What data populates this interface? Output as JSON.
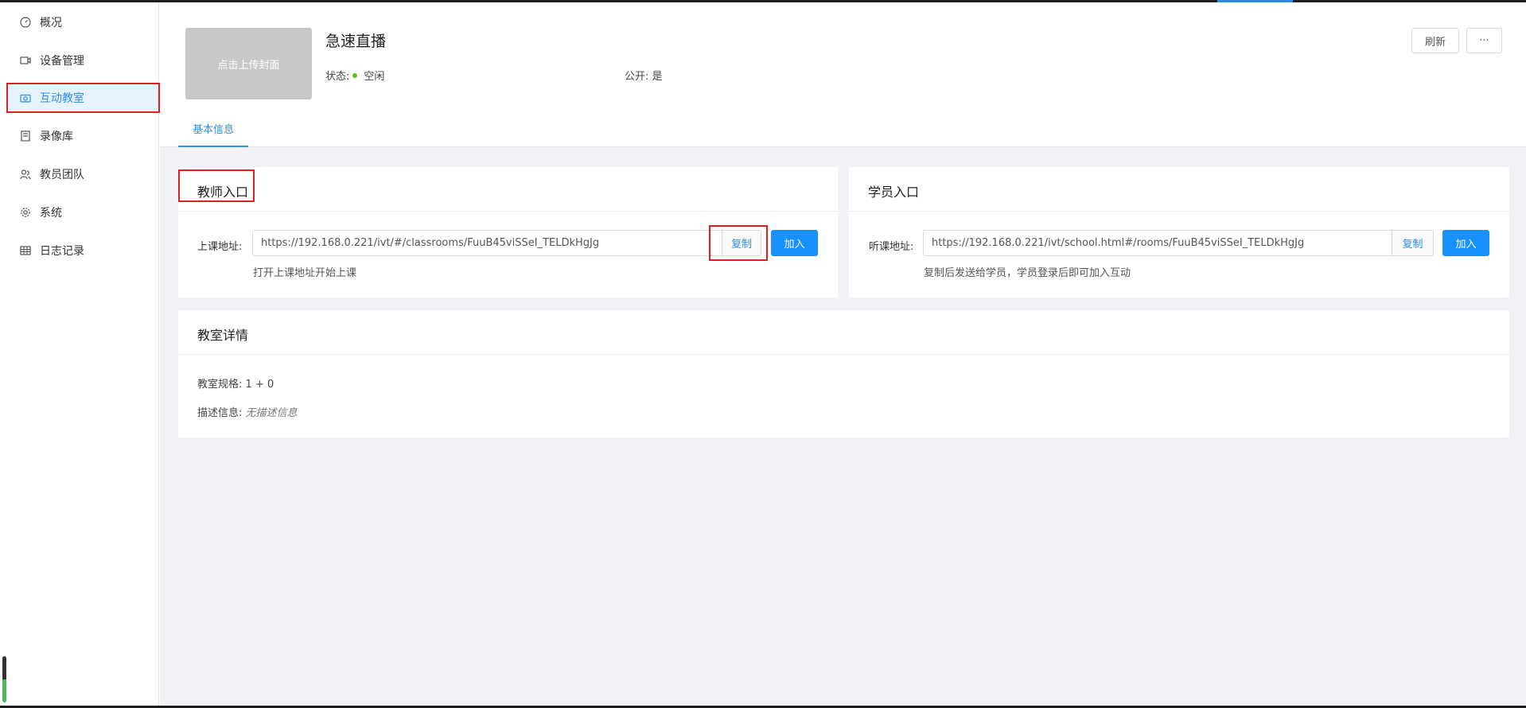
{
  "sidebar": {
    "items": [
      {
        "label": "概况",
        "icon": "dashboard-icon"
      },
      {
        "label": "设备管理",
        "icon": "video-device-icon"
      },
      {
        "label": "互动教室",
        "icon": "camera-icon"
      },
      {
        "label": "录像库",
        "icon": "book-icon"
      },
      {
        "label": "教员团队",
        "icon": "team-icon"
      },
      {
        "label": "系统",
        "icon": "gear-icon"
      },
      {
        "label": "日志记录",
        "icon": "table-icon"
      }
    ],
    "active_index": 2
  },
  "header": {
    "cover_text": "点击上传封面",
    "title": "急速直播",
    "status_label": "状态:",
    "status_value": "空闲",
    "public_label": "公开:",
    "public_value": "是",
    "refresh_label": "刷新",
    "more_label": "···",
    "tab_label": "基本信息"
  },
  "teacher": {
    "title": "教师入口",
    "field_label": "上课地址:",
    "url": "https://192.168.0.221/ivt/#/classrooms/FuuB45viSSeI_TELDkHgJg",
    "copy_label": "复制",
    "join_label": "加入",
    "hint": "打开上课地址开始上课"
  },
  "student": {
    "title": "学员入口",
    "field_label": "听课地址:",
    "url": "https://192.168.0.221/ivt/school.html#/rooms/FuuB45viSSeI_TELDkHgJg",
    "copy_label": "复制",
    "join_label": "加入",
    "hint": "复制后发送给学员，学员登录后即可加入互动"
  },
  "detail": {
    "title": "教室详情",
    "spec_label": "教室规格:",
    "spec_value": "1 + 0",
    "desc_label": "描述信息:",
    "desc_value": "无描述信息"
  },
  "colors": {
    "accent": "#2e8de6",
    "primary_button": "#1890ff",
    "highlight_box": "#e02020",
    "status_idle": "#52c41a"
  }
}
